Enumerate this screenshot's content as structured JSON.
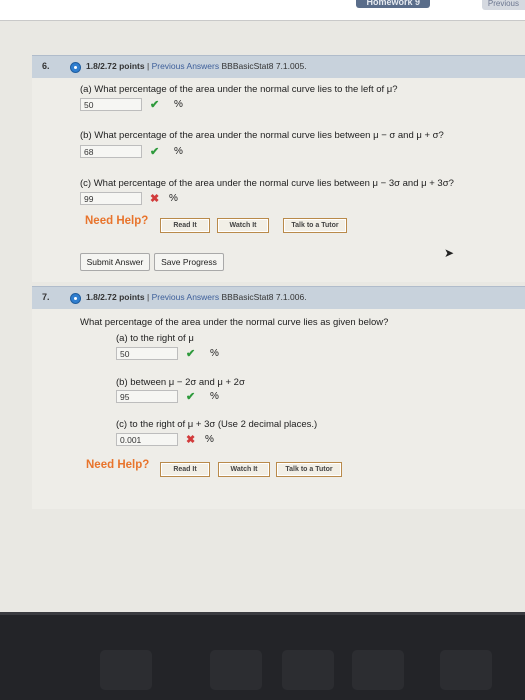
{
  "topbar": {
    "homework_tab": "Homework 9",
    "previous_tab": "Previous"
  },
  "q6": {
    "number": "6.",
    "points": "1.8/2.72 points",
    "separator": "|",
    "previous_answers": "Previous Answers",
    "source": "BBBasicStat8 7.1.005.",
    "a": {
      "prompt": "(a) What percentage of the area under the normal curve lies to the left of μ?",
      "value": "50",
      "unit": "%",
      "status": "correct"
    },
    "b": {
      "prompt": "(b) What percentage of the area under the normal curve lies between μ − σ and μ + σ?",
      "value": "68",
      "unit": "%",
      "status": "correct"
    },
    "c": {
      "prompt": "(c) What percentage of the area under the normal curve lies between μ − 3σ and μ + 3σ?",
      "value": "99",
      "unit": "%",
      "status": "incorrect"
    },
    "need_help": "Need Help?",
    "help_buttons": [
      "Read It",
      "Watch It",
      "Talk to a Tutor"
    ],
    "submit_label": "Submit Answer",
    "save_label": "Save Progress"
  },
  "q7": {
    "number": "7.",
    "points": "1.8/2.72 points",
    "separator": "|",
    "previous_answers": "Previous Answers",
    "source": "BBBasicStat8 7.1.006.",
    "prompt": "What percentage of the area under the normal curve lies as given below?",
    "a": {
      "prompt": "(a) to the right of μ",
      "value": "50",
      "unit": "%",
      "status": "correct"
    },
    "b": {
      "prompt": "(b) between μ − 2σ and μ + 2σ",
      "value": "95",
      "unit": "%",
      "status": "correct"
    },
    "c": {
      "prompt": "(c) to the right of μ + 3σ (Use 2 decimal places.)",
      "value": "0.001",
      "unit": "%",
      "status": "incorrect"
    },
    "need_help": "Need Help?",
    "help_buttons": [
      "Read It",
      "Watch It",
      "Talk to a Tutor"
    ]
  },
  "icons": {
    "correct": "checkmark-icon",
    "incorrect": "cross-icon",
    "status_dot": "radio-dot-icon"
  },
  "glyphs": {
    "check": "✔",
    "cross": "✖",
    "cursor": "➤"
  },
  "colors": {
    "correct": "#2e9a3c",
    "incorrect": "#d23b3b",
    "need_help": "#e8742c",
    "header_bg": "#c8d2dc",
    "link": "#3d5f9a"
  }
}
